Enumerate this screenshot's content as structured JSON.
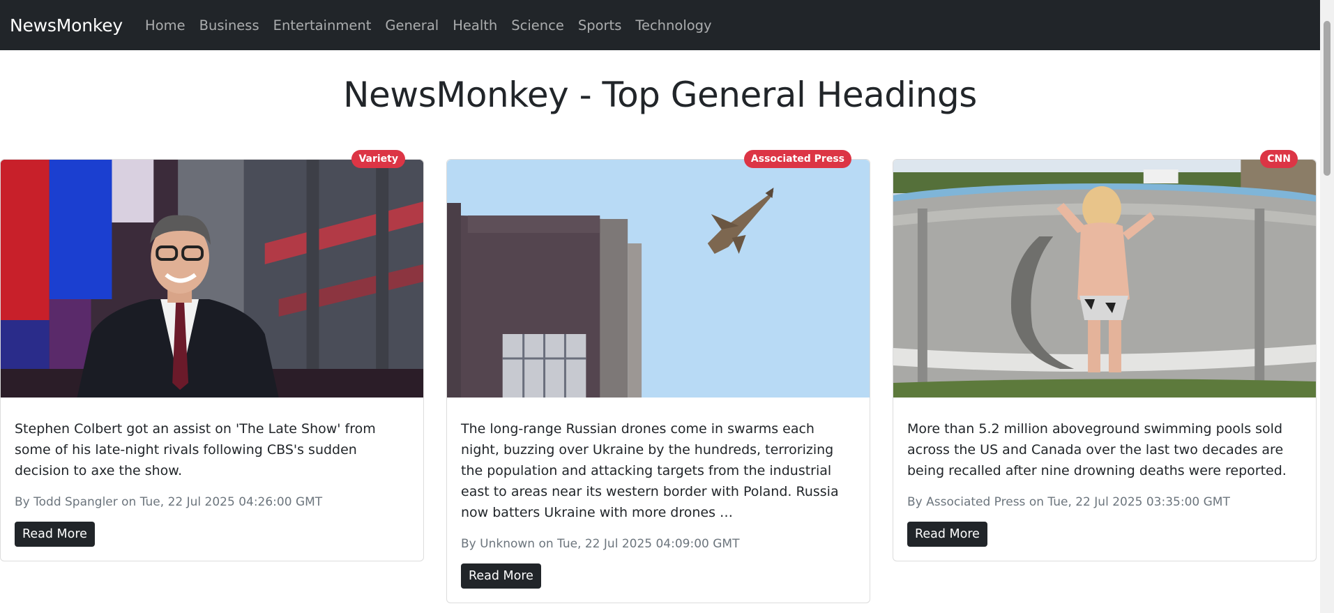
{
  "navbar": {
    "brand": "NewsMonkey",
    "links": [
      "Home",
      "Business",
      "Entertainment",
      "General",
      "Health",
      "Science",
      "Sports",
      "Technology"
    ]
  },
  "page": {
    "title": "NewsMonkey - Top General Headings"
  },
  "articles": [
    {
      "source": "Variety",
      "description": "Stephen Colbert got an assist on 'The Late Show' from some of his late-night rivals following CBS's sudden decision to axe the show.",
      "meta": "By Todd Spangler on Tue, 22 Jul 2025 04:26:00 GMT",
      "button": "Read More"
    },
    {
      "source": "Associated Press",
      "description": "The long-range Russian drones come in swarms each night, buzzing over Ukraine by the hundreds, terrorizing the population and attacking targets from the industrial east to areas near its western border with Poland. Russia now batters Ukraine with more drones …",
      "meta": "By Unknown on Tue, 22 Jul 2025 04:09:00 GMT",
      "button": "Read More"
    },
    {
      "source": "CNN",
      "description": "More than 5.2 million aboveground swimming pools sold across the US and Canada over the last two decades are being recalled after nine drowning deaths were reported.",
      "meta": "By Associated Press on Tue, 22 Jul 2025 03:35:00 GMT",
      "button": "Read More"
    }
  ],
  "colors": {
    "navbar": "#212529",
    "badge": "#dc3545",
    "button": "#212529"
  }
}
